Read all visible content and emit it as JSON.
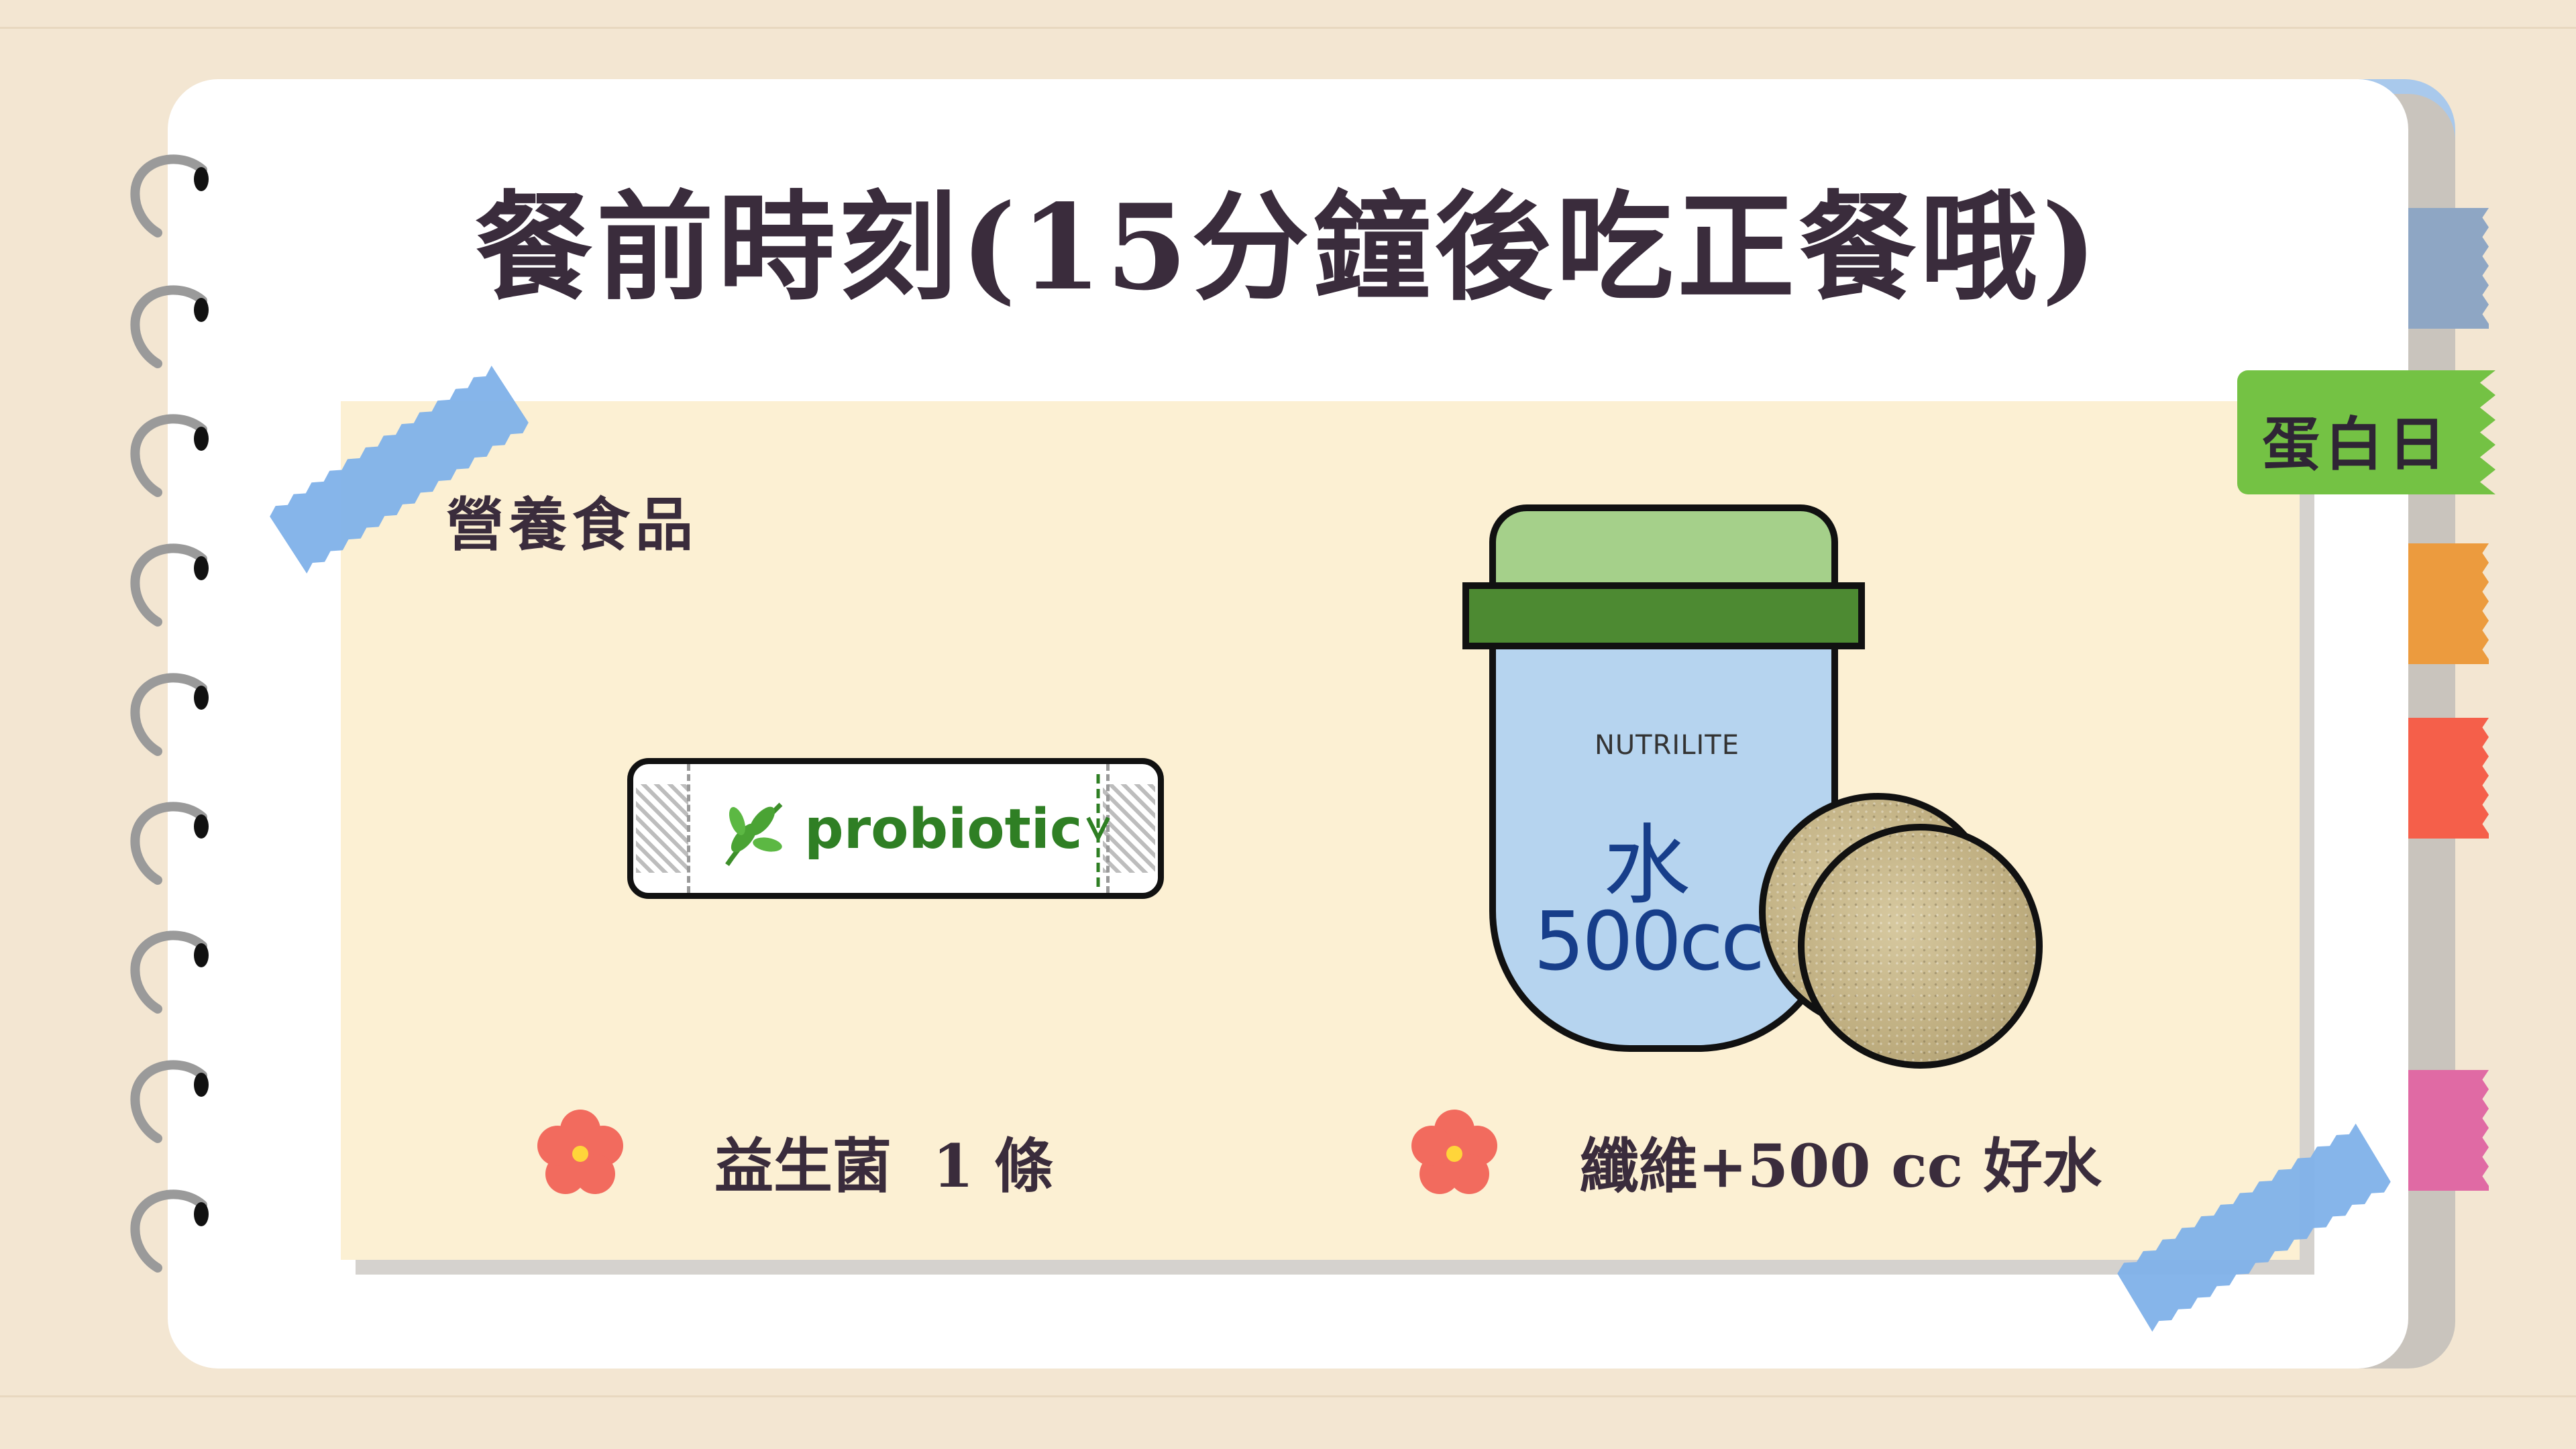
{
  "title": "餐前時刻(15分鐘後吃正餐哦)",
  "subheading": "營養食品",
  "tag": {
    "label": "蛋白日",
    "color": "#74c244"
  },
  "items": [
    {
      "label": "益生菌  1 條",
      "product_text": "probiotic",
      "icon": "probiotic-stick"
    },
    {
      "label": "纖維+500 cc 好水",
      "product_brand": "NUTRILITE",
      "product_water": "水",
      "product_volume": "500cc",
      "icon": "fiber-jar"
    }
  ],
  "tabs": [
    {
      "color": "#8ea6c4"
    },
    {
      "color": "#ec9b3e"
    },
    {
      "color": "#f55f4a"
    },
    {
      "color": "#e06aa4"
    }
  ],
  "colors": {
    "background": "#f3e6d2",
    "page": "#ffffff",
    "panel": "#fcf0d3",
    "title_text": "#3a2c3c",
    "tape": "#7fb1e9",
    "flower": "#f26b5e"
  }
}
